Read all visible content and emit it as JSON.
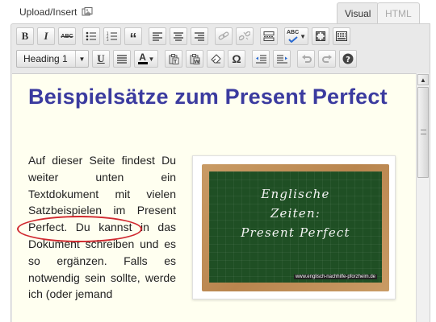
{
  "header": {
    "upload_label": "Upload/Insert",
    "upload_icon": "media-icon",
    "tabs": [
      {
        "label": "Visual",
        "active": true
      },
      {
        "label": "HTML",
        "active": false
      }
    ]
  },
  "toolbar": {
    "row1": [
      "bold",
      "italic",
      "strikethrough",
      "bullet-list",
      "numbered-list",
      "blockquote",
      "align-left",
      "align-center",
      "align-right",
      "insert-link",
      "remove-link",
      "insert-more",
      "spellcheck",
      "fullscreen",
      "show-kitchen-sink"
    ],
    "row2": [
      "format-select",
      "underline",
      "justify",
      "text-color",
      "paste-as-text",
      "paste-from-word",
      "remove-format",
      "special-character",
      "outdent",
      "indent",
      "undo",
      "redo",
      "help"
    ],
    "bold_label": "B",
    "italic_label": "I",
    "strike_label": "ABC",
    "quote_label": "“",
    "spell_label": "ABC",
    "underline_label": "U",
    "omega_label": "Ω",
    "color_label": "A",
    "format_value": "Heading 1"
  },
  "content": {
    "heading": "Beispielsätze zum Present Perfect",
    "paragraph": "Auf dieser Seite findest Du weiter unten ein Textdokument mit vielen Satzbeispielen im Present Perfect. Du kannst in das Dokument schreiben und es so ergänzen. Falls es notwendig sein sollte, werde ich (oder jemand",
    "image": {
      "line1": "Englische",
      "line2": "Zeiten:",
      "line3": "Present Perfect",
      "url": "www.englisch-nachhilfe-pforzheim.de"
    }
  },
  "colors": {
    "heading": "#3b3b9f",
    "content_background": "#fffff0",
    "annotation": "#d0282f",
    "chalkboard": "#1f4f24"
  }
}
